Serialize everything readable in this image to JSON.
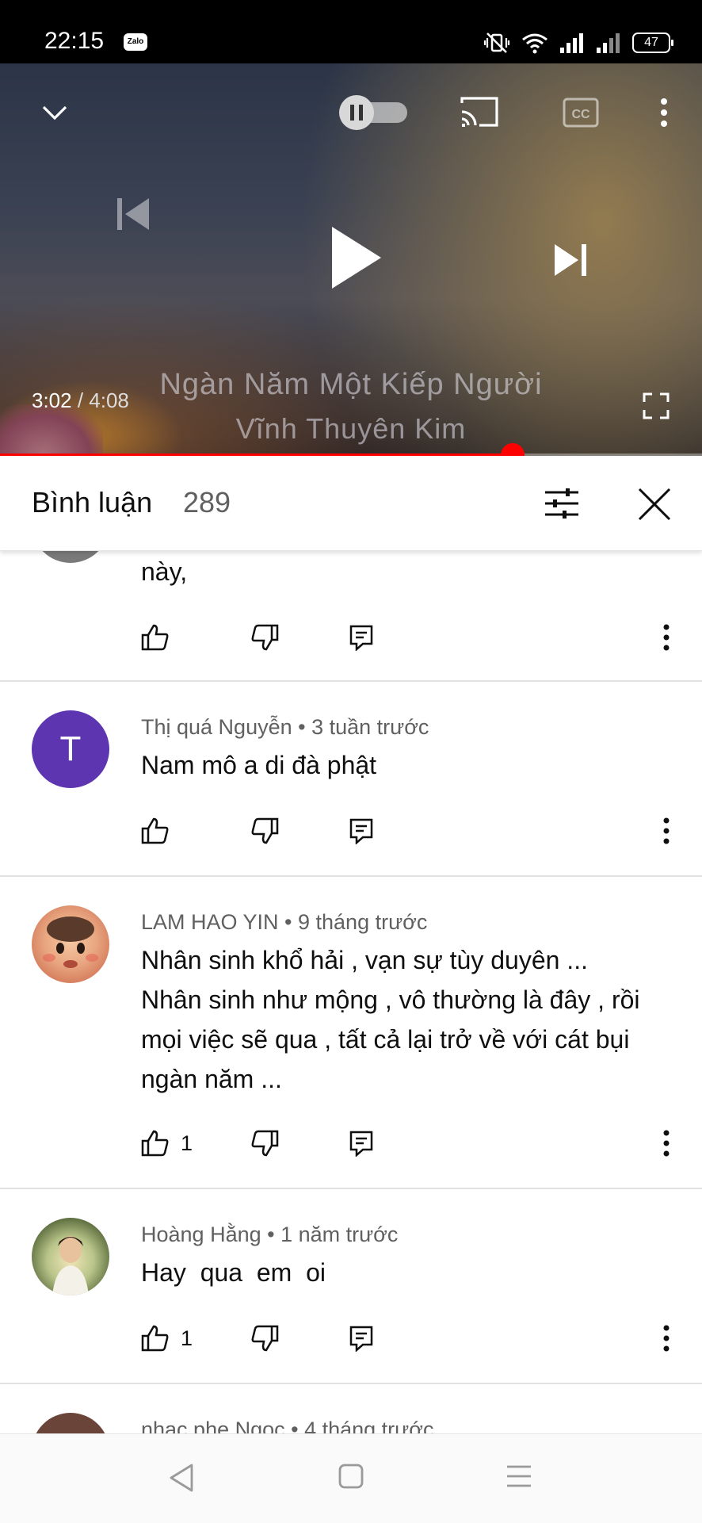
{
  "status_bar": {
    "time": "22:15",
    "zalo_label": "Zalo",
    "battery": "47",
    "icons": [
      "vibrate-off-icon",
      "wifi-icon",
      "signal-icon",
      "signal-icon"
    ]
  },
  "player": {
    "current_time": "3:02",
    "duration": "4:08",
    "progress_fraction": 0.73,
    "overlay_line1": "Ngàn Năm Một Kiếp Người",
    "overlay_line2": "Vĩnh Thuyên Kim",
    "accent_color": "#ff0000"
  },
  "comments_header": {
    "title": "Bình luận",
    "count": "289"
  },
  "comments": [
    {
      "author": "",
      "time": "",
      "text": "này,",
      "likes": ""
    },
    {
      "author": "Thị quá Nguyễn",
      "time": "3 tuần trước",
      "text": "Nam mô a di đà phật",
      "likes": "",
      "avatar_letter": "T"
    },
    {
      "author": "LAM HAO YIN",
      "time": "9 tháng trước",
      "text": "Nhân sinh khổ hải , vạn sự tùy duyên ...\nNhân sinh như mộng , vô thường là đây , rồi mọi việc sẽ qua , tất cả lại trở về với cát bụi ngàn năm ...",
      "likes": "1"
    },
    {
      "author": "Hoàng Hằng",
      "time": "1 năm trước",
      "text": "Hay  qua  em  oi",
      "likes": "1"
    },
    {
      "author": "nhac phe Ngoc",
      "time": "4 tháng trước",
      "text": "",
      "likes": ""
    }
  ],
  "comment_meta": [
    "Thị quá Nguyễn • 3 tuần trước",
    "LAM HAO YIN • 9 tháng trước",
    "Hoàng Hằng • 1 năm trước",
    "nhac phe Ngoc • 4 tháng trước"
  ]
}
